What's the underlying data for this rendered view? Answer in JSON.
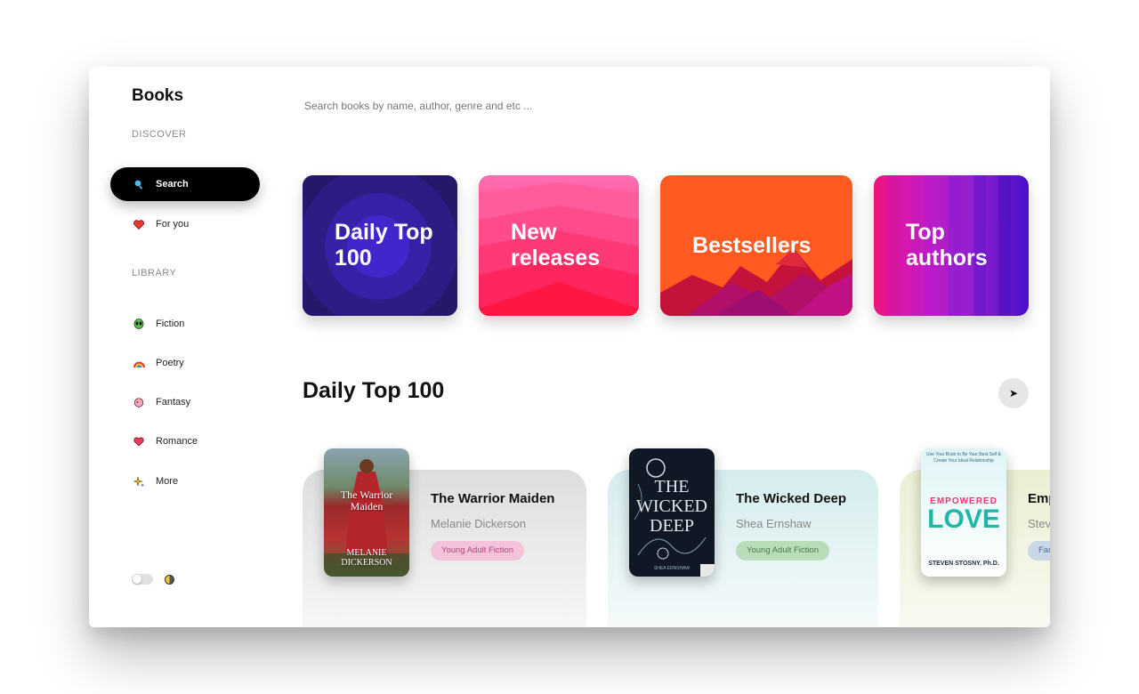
{
  "app": {
    "title": "Books"
  },
  "sidebar": {
    "discover_label": "DISCOVER",
    "library_label": "LIBRARY",
    "discover_items": [
      {
        "label": "Search",
        "icon": "search-icon",
        "active": true
      },
      {
        "label": "For you",
        "icon": "heart-icon",
        "active": false
      }
    ],
    "library_items": [
      {
        "label": "Fiction",
        "icon": "alien-icon"
      },
      {
        "label": "Poetry",
        "icon": "rainbow-icon"
      },
      {
        "label": "Fantasy",
        "icon": "unicorn-icon"
      },
      {
        "label": "Romance",
        "icon": "love-icon"
      },
      {
        "label": "More",
        "icon": "sparkles-icon"
      }
    ]
  },
  "search": {
    "placeholder": "Search books by name, author, genre and etc ..."
  },
  "categories": [
    {
      "label": "Daily Top 100",
      "color": "#2a1b6e"
    },
    {
      "label": "New releases",
      "color": "#ff3d7f"
    },
    {
      "label": "Bestsellers",
      "color": "#ff5a1f"
    },
    {
      "label": "Top authors",
      "color": "#a21fd0"
    }
  ],
  "section": {
    "title": "Daily Top 100",
    "next_icon": "arrow-right-icon"
  },
  "books": [
    {
      "title": "The Warrior Maiden",
      "author": "Melanie Dickerson",
      "genre": "Young Adult Fiction",
      "cover_title": "The Warrior Maiden",
      "cover_author": "MELANIE DICKERSON",
      "card_color": "#e4e5e6",
      "tag_bg": "#f2c3db",
      "tag_color": "#b0457a"
    },
    {
      "title": "The Wicked Deep",
      "author": "Shea Ernshaw",
      "genre": "Young Adult Fiction",
      "cover_title": "THE WICKED DEEP",
      "cover_author": "SHEA ERNSHAW",
      "card_color": "#d9eef0",
      "tag_bg": "#b9dcb9",
      "tag_color": "#4a7a4a"
    },
    {
      "title": "Empowered Love",
      "author": "Steven Stosny",
      "genre": "Family",
      "cover_subtitle": "Use Your Brain to Be Your Best Self & Create Your Ideal Relationship",
      "cover_title_a": "EMPOWERED",
      "cover_title_b": "LOVE",
      "cover_author": "STEVEN STOSNY, Ph.D.",
      "card_color": "#edf2dc",
      "tag_bg": "#c9d7e8",
      "tag_color": "#52688a"
    }
  ]
}
